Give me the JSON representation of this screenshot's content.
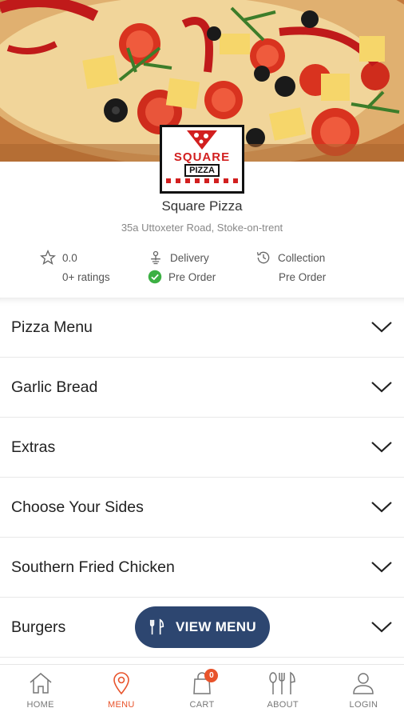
{
  "restaurant": {
    "name": "Square Pizza",
    "address": "35a Uttoxeter Road, Stoke-on-trent",
    "logo_text_top": "SQUARE",
    "logo_text_bottom": "PIZZA"
  },
  "info": {
    "rating_value": "0.0",
    "ratings_count": "0+ ratings",
    "delivery_label": "Delivery",
    "delivery_status": "Pre Order",
    "collection_label": "Collection",
    "collection_status": "Pre Order"
  },
  "menu": {
    "categories": [
      "Pizza Menu",
      "Garlic Bread",
      "Extras",
      "Choose Your Sides",
      "Southern Fried Chicken",
      "Burgers"
    ]
  },
  "view_menu_label": "VIEW MENU",
  "nav": {
    "home": "HOME",
    "menu": "MENU",
    "cart": "CART",
    "cart_count": "0",
    "about": "ABOUT",
    "login": "LOGIN"
  },
  "colors": {
    "accent": "#e8532b",
    "button": "#2d4670",
    "success": "#3cb043"
  }
}
